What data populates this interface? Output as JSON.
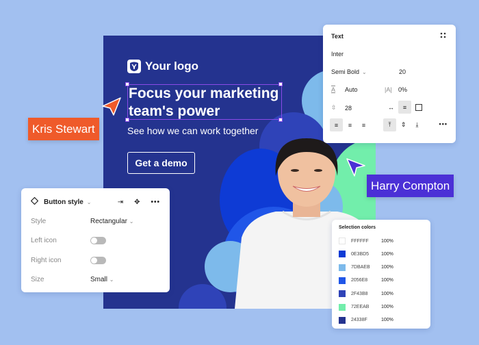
{
  "banner": {
    "logo_text": "Your logo",
    "headline": "Focus your marketing team's power",
    "subline": "See how we can work together",
    "cta_label": "Get a demo",
    "background_color": "#24338F"
  },
  "text_panel": {
    "title": "Text",
    "font_family": "Inter",
    "font_weight": "Semi Bold",
    "font_size": "20",
    "letter_height": "Auto",
    "letter_spacing": "0%",
    "line_height": "28"
  },
  "button_panel": {
    "title": "Button style",
    "rows": [
      {
        "label": "Style",
        "value": "Rectangular",
        "type": "select"
      },
      {
        "label": "Left icon",
        "type": "toggle",
        "on": false
      },
      {
        "label": "Right icon",
        "type": "toggle",
        "on": false
      },
      {
        "label": "Size",
        "value": "Small",
        "type": "select"
      }
    ]
  },
  "colors_panel": {
    "title": "Selection colors",
    "colors": [
      {
        "hex": "FFFFFF",
        "opacity": "100%",
        "color": "#FFFFFF"
      },
      {
        "hex": "0E3BD5",
        "opacity": "100%",
        "color": "#0E3BD5"
      },
      {
        "hex": "7DBAEB",
        "opacity": "100%",
        "color": "#7DBAEB"
      },
      {
        "hex": "2056E8",
        "opacity": "100%",
        "color": "#2056E8"
      },
      {
        "hex": "2F43B8",
        "opacity": "100%",
        "color": "#2F43B8"
      },
      {
        "hex": "72EEAB",
        "opacity": "100%",
        "color": "#72EEAB"
      },
      {
        "hex": "24338F",
        "opacity": "100%",
        "color": "#24338F"
      }
    ]
  },
  "collaborators": [
    {
      "name": "Kris Stewart",
      "color": "#EF5A2A"
    },
    {
      "name": "Harry Compton",
      "color": "#4B30D6"
    }
  ]
}
